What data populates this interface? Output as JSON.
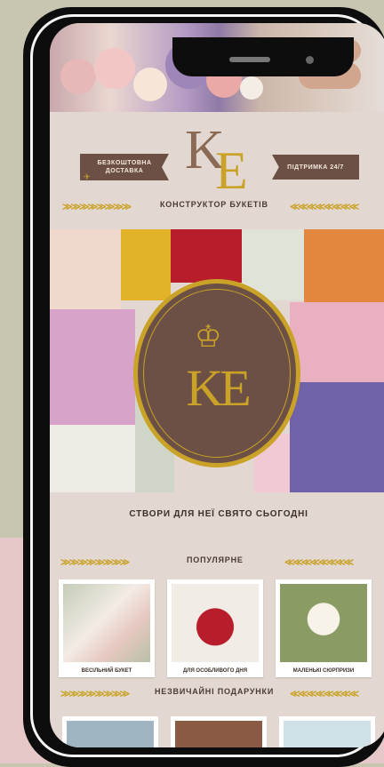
{
  "header": {
    "left_ribbon": "БЕЗКОШТОВНА ДОСТАВКА",
    "right_ribbon": "ПІДТРИМКА 24/7",
    "logo_k": "K",
    "logo_e": "E",
    "subtitle": "КОНСТРУКТОР БУКЕТІВ"
  },
  "medallion": {
    "monogram": "KE",
    "crown": "♔"
  },
  "cta": "СТВОРИ ДЛЯ НЕЇ СВЯТО СЬОГОДНІ",
  "popular": {
    "title": "ПОПУЛЯРНЕ",
    "items": [
      {
        "label": "ВЕСІЛЬНИЙ БУКЕТ"
      },
      {
        "label": "ДЛЯ ОСОБЛИВОГО ДНЯ"
      },
      {
        "label": "МАЛЕНЬКІ СЮРПРИЗИ"
      }
    ]
  },
  "gifts": {
    "title": "НЕЗВИЧАЙНІ ПОДАРУНКИ"
  },
  "decor": {
    "arrow_left": "≫≫≫≫≫≫≫≫",
    "arrow_right": "≪≪≪≪≪≪≪≪",
    "delivery_icon": "✈"
  },
  "colors": {
    "gold": "#c9a227",
    "brown": "#6d5045",
    "screen_bg": "#e2d8d1"
  }
}
